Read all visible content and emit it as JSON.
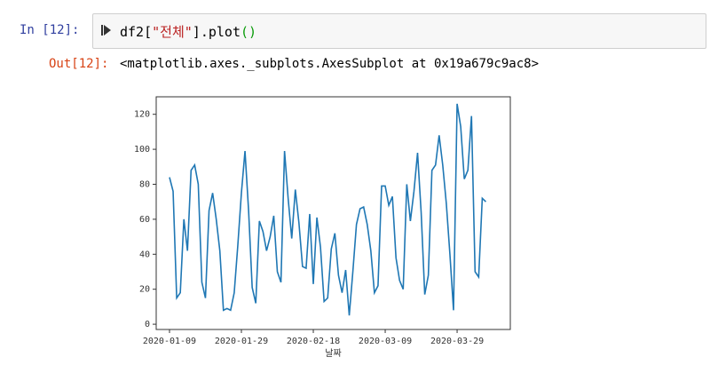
{
  "cell": {
    "in_prompt": "In [12]:",
    "out_prompt": "Out[12]:",
    "code_prefix": "df2[",
    "code_string": "\"전체\"",
    "code_mid": "].plot",
    "code_parens": "()",
    "output_text": "<matplotlib.axes._subplots.AxesSubplot at 0x19a679c9ac8>"
  },
  "colors": {
    "line": "#1f77b4",
    "in_prompt": "#303f9f",
    "out_prompt": "#d84315"
  },
  "chart_data": {
    "type": "line",
    "title": "",
    "xlabel": "날짜",
    "ylabel": "",
    "start_date": "2020-01-09",
    "series": [
      {
        "name": "전체",
        "values": [
          84,
          76,
          15,
          18,
          60,
          42,
          88,
          91,
          80,
          24,
          15,
          65,
          75,
          60,
          42,
          8,
          9,
          8,
          18,
          45,
          75,
          99,
          65,
          21,
          12,
          59,
          53,
          42,
          50,
          62,
          30,
          24,
          99,
          72,
          49,
          77,
          58,
          33,
          32,
          63,
          23,
          61,
          44,
          13,
          15,
          43,
          52,
          28,
          18,
          31,
          5,
          30,
          57,
          66,
          67,
          57,
          42,
          18,
          22,
          79,
          79,
          68,
          73,
          38,
          25,
          20,
          80,
          59,
          76,
          98,
          64,
          17,
          28,
          88,
          91,
          108,
          91,
          69,
          40,
          8,
          126,
          113,
          83,
          88,
          119,
          30,
          27,
          72,
          70
        ]
      }
    ],
    "xticks": [
      "2020-01-09",
      "2020-01-29",
      "2020-02-18",
      "2020-03-09",
      "2020-03-29"
    ],
    "xtick_days": [
      0,
      20,
      40,
      60,
      80
    ],
    "yticks": [
      "0",
      "20",
      "40",
      "60",
      "80",
      "100",
      "120"
    ],
    "ytick_values": [
      0,
      20,
      40,
      60,
      80,
      100,
      120
    ],
    "ylim": [
      -3,
      130
    ],
    "xlim_days": [
      -3.7,
      94.8
    ],
    "grid": false
  }
}
